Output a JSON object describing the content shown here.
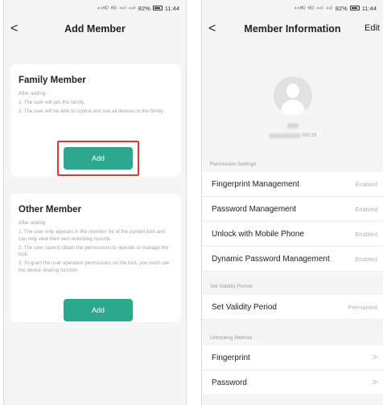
{
  "status": {
    "left_phone": {
      "signal": "⁴⁶ᴴᴰ ᴴᴰ ⁴⁶ᴵ ⁴⁶ᴵ",
      "battery": "82%",
      "time": "11:44"
    },
    "right_phone": {
      "signal": "⁴⁶ᴴᴰ ᴴᴰ ⁴⁶ᴵ ⁴⁶ᴵ",
      "battery": "82%",
      "time": "11:44"
    }
  },
  "add_member": {
    "back": "<",
    "title": "Add Member",
    "family": {
      "title": "Family Member",
      "lines": [
        "After adding:",
        "1. The user will join the family.",
        "2. The user will be able to control and use all devices in the family."
      ],
      "button": "Add"
    },
    "other": {
      "title": "Other Member",
      "lines": [
        "After adding:",
        "1. The user only appears in the member list of the current lock and can only view their own unlocking records.",
        "2. The user cannot obtain the permissions to operate or manage the lock.",
        "3. To grant the user operation permissions on the lock, you must use the device sharing function."
      ],
      "button": "Add"
    }
  },
  "member_info": {
    "back": "<",
    "title": "Member Information",
    "edit": "Edit",
    "phone_suffix": "98138",
    "permission_section": "Permission Settings",
    "permissions": [
      {
        "label": "Fingerprint Management",
        "value": "Enabled"
      },
      {
        "label": "Password Management",
        "value": "Enabled"
      },
      {
        "label": "Unlock with Mobile Phone",
        "value": "Enabled"
      },
      {
        "label": "Dynamic Password Management",
        "value": "Enabled"
      }
    ],
    "validity_section": "Set Validity Period",
    "validity": {
      "label": "Set Validity Period",
      "value": "Permanent"
    },
    "method_section": "Unlocking Method",
    "methods": [
      {
        "label": "Fingerprint",
        "value": ">"
      },
      {
        "label": "Password",
        "value": ">"
      }
    ]
  },
  "colors": {
    "accent": "#2ca88e",
    "highlight": "#e0392f"
  }
}
